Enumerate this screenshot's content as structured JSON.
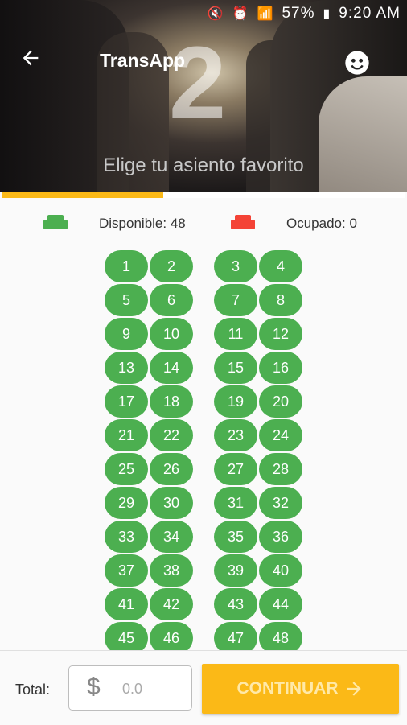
{
  "status_bar": {
    "battery": "57%",
    "time": "9:20 AM"
  },
  "app_bar": {
    "title": "TransApp",
    "back_icon": "arrow-left-icon",
    "user_icon": "account-circle-icon"
  },
  "step": {
    "number": "2",
    "subtitle": "Elige tu asiento favorito",
    "progress": 0.4
  },
  "legend": {
    "available_label": "Disponible: 48",
    "occupied_label": "Ocupado: 0",
    "available_color": "#4caf50",
    "occupied_color": "#f44336"
  },
  "seats": [
    "1",
    "2",
    "3",
    "4",
    "5",
    "6",
    "7",
    "8",
    "9",
    "10",
    "11",
    "12",
    "13",
    "14",
    "15",
    "16",
    "17",
    "18",
    "19",
    "20",
    "21",
    "22",
    "23",
    "24",
    "25",
    "26",
    "27",
    "28",
    "29",
    "30",
    "31",
    "32",
    "33",
    "34",
    "35",
    "36",
    "37",
    "38",
    "39",
    "40",
    "41",
    "42",
    "43",
    "44",
    "45",
    "46",
    "47",
    "48"
  ],
  "footer": {
    "total_label": "Total:",
    "currency": "$",
    "total_value": "0.0",
    "continue_label": "CONTINUAR"
  },
  "colors": {
    "accent": "#fbb917",
    "seat_available": "#4caf50"
  }
}
